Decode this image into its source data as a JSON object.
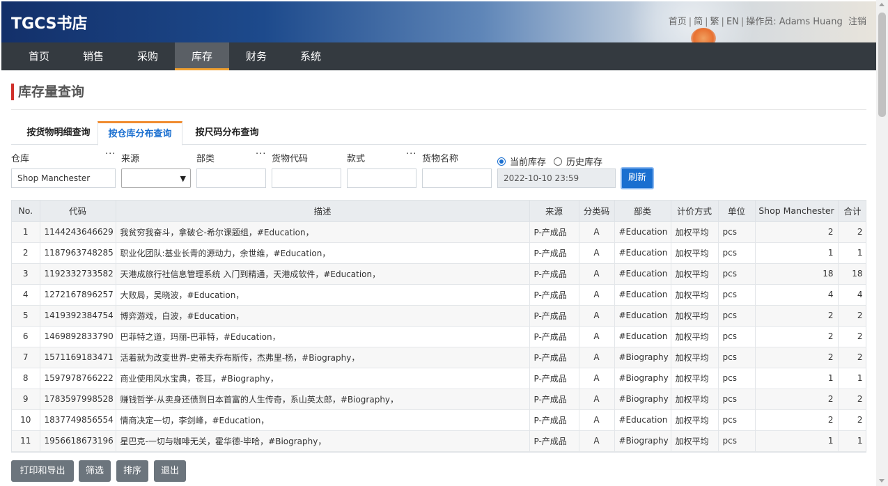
{
  "header": {
    "brand": "TGCS书店",
    "links": [
      "首页",
      "简",
      "繁",
      "EN"
    ],
    "operator_label": "操作员: Adams Huang",
    "logout": "注销"
  },
  "nav": {
    "items": [
      "首页",
      "销售",
      "采购",
      "库存",
      "财务",
      "系统"
    ],
    "active": "库存"
  },
  "page": {
    "title": "库存量查询"
  },
  "tabs": [
    "按货物明细查询",
    "按仓库分布查询",
    "按尺码分布查询"
  ],
  "active_tab": "按仓库分布查询",
  "filters": {
    "warehouse_label": "仓库",
    "warehouse_value": "Shop Manchester",
    "source_label": "来源",
    "category_label": "部类",
    "code_label": "货物代码",
    "style_label": "款式",
    "name_label": "货物名称",
    "more": "···",
    "radio_current": "当前库存",
    "radio_history": "历史库存",
    "date_value": "2022-10-10 23:59",
    "refresh": "刷新"
  },
  "table": {
    "headers": [
      "No.",
      "代码",
      "描述",
      "来源",
      "分类码",
      "部类",
      "计价方式",
      "单位",
      "Shop Manchester",
      "合计"
    ],
    "rows": [
      [
        "1",
        "1144243646629",
        "我贫穷我奋斗，拿破仑-希尔课题组，#Education，",
        "P-产成品",
        "A",
        "#Education",
        "加权平均",
        "pcs",
        "2",
        "2"
      ],
      [
        "2",
        "1187963748285",
        "职业化团队:基业长青的源动力，余世维，#Education，",
        "P-产成品",
        "A",
        "#Education",
        "加权平均",
        "pcs",
        "1",
        "1"
      ],
      [
        "3",
        "1192332733582",
        "天港成旅行社信息管理系统 入门到精通，天港成软件，#Education，",
        "P-产成品",
        "A",
        "#Education",
        "加权平均",
        "pcs",
        "18",
        "18"
      ],
      [
        "4",
        "1272167896257",
        "大败局，吴晓波，#Education，",
        "P-产成品",
        "A",
        "#Education",
        "加权平均",
        "pcs",
        "4",
        "4"
      ],
      [
        "5",
        "1419392384754",
        "博弈游戏，白波，#Education，",
        "P-产成品",
        "A",
        "#Education",
        "加权平均",
        "pcs",
        "2",
        "2"
      ],
      [
        "6",
        "1469892833790",
        "巴菲特之道，玛丽-巴菲特，#Education，",
        "P-产成品",
        "A",
        "#Education",
        "加权平均",
        "pcs",
        "2",
        "2"
      ],
      [
        "7",
        "1571169183471",
        "活着就为改变世界-史蒂夫乔布斯传，杰弗里-杨，#Biography，",
        "P-产成品",
        "A",
        "#Biography",
        "加权平均",
        "pcs",
        "2",
        "2"
      ],
      [
        "8",
        "1597978766222",
        "商业使用风水宝典，苍耳，#Biography，",
        "P-产成品",
        "A",
        "#Biography",
        "加权平均",
        "pcs",
        "1",
        "1"
      ],
      [
        "9",
        "1783597998528",
        "赚钱哲学-从卖身还债到日本首富的人生传奇，系山英太郎，#Biography，",
        "P-产成品",
        "A",
        "#Biography",
        "加权平均",
        "pcs",
        "2",
        "2"
      ],
      [
        "10",
        "1837749856554",
        "情商决定一切，李剑峰，#Education，",
        "P-产成品",
        "A",
        "#Education",
        "加权平均",
        "pcs",
        "2",
        "2"
      ],
      [
        "11",
        "1956618673196",
        "星巴克-一切与咖啡无关，霍华德-毕哈，#Biography，",
        "P-产成品",
        "A",
        "#Biography",
        "加权平均",
        "pcs",
        "1",
        "1"
      ]
    ]
  },
  "actions": [
    "打印和导出",
    "筛选",
    "排序",
    "退出"
  ],
  "colors": {
    "nav_bg": "#343a40",
    "accent": "#1a6fd0",
    "tab_active_border": "#f08c30",
    "title_bar": "#d0302a"
  }
}
